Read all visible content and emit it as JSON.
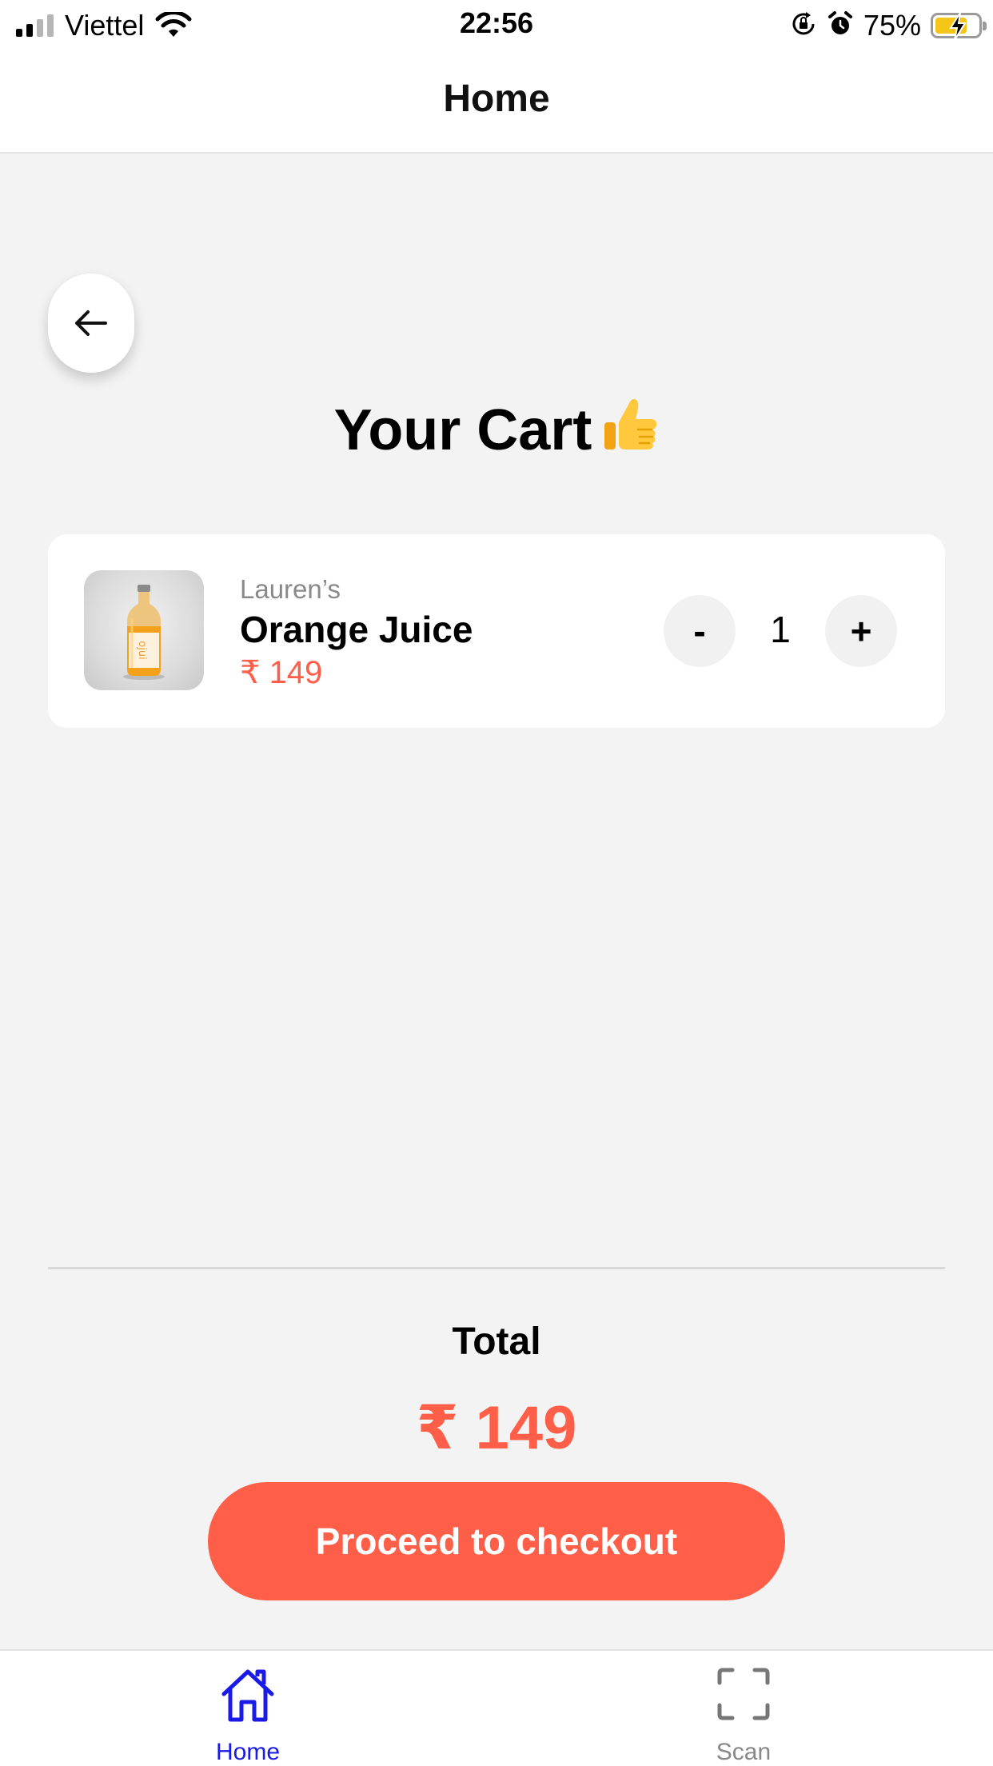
{
  "status_bar": {
    "carrier": "Viettel",
    "time": "22:56",
    "battery_percent": "75%",
    "battery_level": 0.75,
    "charging": true,
    "signal_bars": 2,
    "signal_bars_total": 4
  },
  "header": {
    "title": "Home"
  },
  "cart": {
    "title": "Your Cart",
    "title_emoji": "thumbs-up-icon",
    "items": [
      {
        "brand": "Lauren’s",
        "name": "Orange Juice",
        "price": "₹ 149",
        "quantity": "1",
        "decrease_label": "-",
        "increase_label": "+",
        "image": "orange-juice-bottle-icon"
      }
    ]
  },
  "summary": {
    "total_label": "Total",
    "total_value": "₹ 149",
    "checkout_label": "Proceed to checkout"
  },
  "tab_bar": {
    "tabs": [
      {
        "label": "Home",
        "icon": "home-icon",
        "active": true
      },
      {
        "label": "Scan",
        "icon": "scan-icon",
        "active": false
      }
    ]
  },
  "colors": {
    "accent": "#ff5f48",
    "tab_active": "#1a1ae6",
    "tab_inactive": "#888888",
    "background": "#f3f3f3"
  }
}
